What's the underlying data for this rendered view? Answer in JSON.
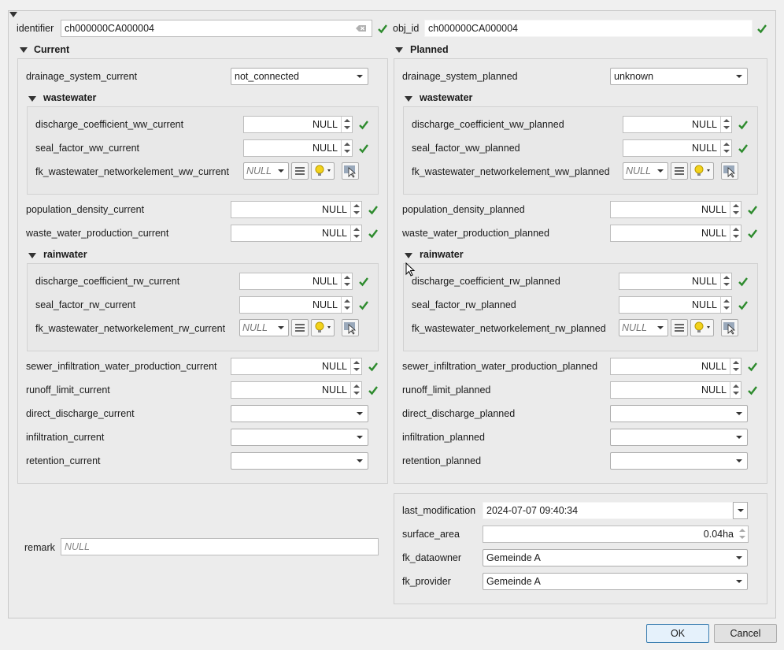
{
  "top": {
    "identifier_label": "identifier",
    "identifier_value": "ch000000CA000004",
    "obj_id_label": "obj_id",
    "obj_id_value": "ch000000CA000004"
  },
  "current": {
    "title": "Current",
    "drainage_label": "drainage_system_current",
    "drainage_value": "not_connected",
    "ww_title": "wastewater",
    "dc_ww_label": "discharge_coefficient_ww_current",
    "dc_ww_value": "NULL",
    "sf_ww_label": "seal_factor_ww_current",
    "sf_ww_value": "NULL",
    "fk_ww_label": "fk_wastewater_networkelement_ww_current",
    "fk_ww_value": "NULL",
    "pop_label": "population_density_current",
    "pop_value": "NULL",
    "wwp_label": "waste_water_production_current",
    "wwp_value": "NULL",
    "rw_title": "rainwater",
    "dc_rw_label": "discharge_coefficient_rw_current",
    "dc_rw_value": "NULL",
    "sf_rw_label": "seal_factor_rw_current",
    "sf_rw_value": "NULL",
    "fk_rw_label": "fk_wastewater_networkelement_rw_current",
    "fk_rw_value": "NULL",
    "siw_label": "sewer_infiltration_water_production_current",
    "siw_value": "NULL",
    "rl_label": "runoff_limit_current",
    "rl_value": "NULL",
    "dd_label": "direct_discharge_current",
    "dd_value": "",
    "inf_label": "infiltration_current",
    "inf_value": "",
    "ret_label": "retention_current",
    "ret_value": ""
  },
  "planned": {
    "title": "Planned",
    "drainage_label": "drainage_system_planned",
    "drainage_value": "unknown",
    "ww_title": "wastewater",
    "dc_ww_label": "discharge_coefficient_ww_planned",
    "dc_ww_value": "NULL",
    "sf_ww_label": "seal_factor_ww_planned",
    "sf_ww_value": "NULL",
    "fk_ww_label": "fk_wastewater_networkelement_ww_planned",
    "fk_ww_value": "NULL",
    "pop_label": "population_density_planned",
    "pop_value": "NULL",
    "wwp_label": "waste_water_production_planned",
    "wwp_value": "NULL",
    "rw_title": "rainwater",
    "dc_rw_label": "discharge_coefficient_rw_planned",
    "dc_rw_value": "NULL",
    "sf_rw_label": "seal_factor_rw_planned",
    "sf_rw_value": "NULL",
    "fk_rw_label": "fk_wastewater_networkelement_rw_planned",
    "fk_rw_value": "NULL",
    "siw_label": "sewer_infiltration_water_production_planned",
    "siw_value": "NULL",
    "rl_label": "runoff_limit_planned",
    "rl_value": "NULL",
    "dd_label": "direct_discharge_planned",
    "dd_value": "",
    "inf_label": "infiltration_planned",
    "inf_value": "",
    "ret_label": "retention_planned",
    "ret_value": ""
  },
  "meta": {
    "last_mod_label": "last_modification",
    "last_mod_value": "2024-07-07 09:40:34",
    "area_label": "surface_area",
    "area_value": "0.04ha",
    "dataowner_label": "fk_dataowner",
    "dataowner_value": "Gemeinde A",
    "provider_label": "fk_provider",
    "provider_value": "Gemeinde A"
  },
  "remark": {
    "label": "remark",
    "placeholder": "NULL"
  },
  "buttons": {
    "ok": "OK",
    "cancel": "Cancel"
  },
  "colors": {
    "check": "#2e8b2e",
    "accent": "#3c7fb1"
  }
}
